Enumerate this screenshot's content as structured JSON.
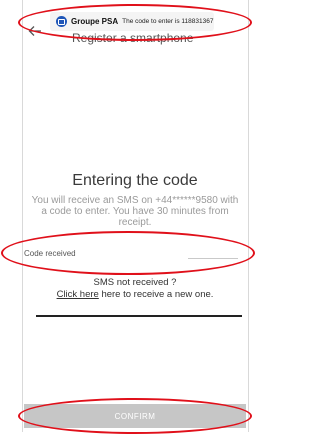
{
  "appbar": {
    "title": "Register a smartphone"
  },
  "notification": {
    "sender": "Groupe PSA",
    "message": "The code to enter is 118831367"
  },
  "main": {
    "heading": "Entering the code",
    "info": "You will receive an SMS on +44******9580 with a code to enter. You have 30 minutes from receipt.",
    "code_field": {
      "placeholder": "Code received",
      "value": ""
    },
    "sms_question": "SMS not received ?",
    "sms_link": "Click here",
    "sms_suffix": " here to receive a new one."
  },
  "footer": {
    "confirm_label": "CONFIRM"
  },
  "colors": {
    "highlight": "#e0101a",
    "confirm_bg": "#c6c6c6",
    "notification_logo": "#1f56b8"
  },
  "icons": {
    "back": "back-arrow-icon",
    "notification_logo": "groupe-psa-logo-icon"
  }
}
